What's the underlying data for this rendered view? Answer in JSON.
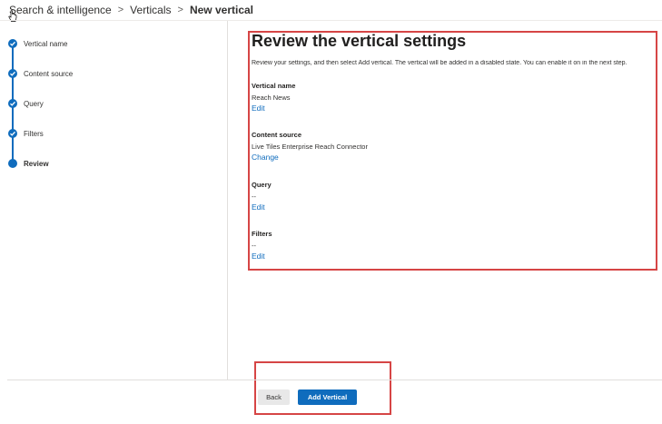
{
  "breadcrumb": {
    "items": [
      "Search & intelligence",
      "Verticals"
    ],
    "current": "New vertical",
    "separator": ">"
  },
  "stepper": {
    "steps": [
      {
        "label": "Vertical name",
        "state": "complete"
      },
      {
        "label": "Content source",
        "state": "complete"
      },
      {
        "label": "Query",
        "state": "complete"
      },
      {
        "label": "Filters",
        "state": "complete"
      },
      {
        "label": "Review",
        "state": "active"
      }
    ],
    "accent": "#0f6cbd"
  },
  "review": {
    "title": "Review the vertical settings",
    "intro": "Review your settings, and then select Add vertical. The vertical will be added in a disabled state. You can enable it on in the next step.",
    "sections": [
      {
        "title": "Vertical name",
        "value": "Reach News",
        "action": "Edit"
      },
      {
        "title": "Content source",
        "value": "Live Tiles Enterprise Reach Connector",
        "action": "Change"
      },
      {
        "title": "Query",
        "value": "--",
        "action": "Edit"
      },
      {
        "title": "Filters",
        "value": "--",
        "action": "Edit"
      }
    ]
  },
  "footer": {
    "back_label": "Back",
    "add_label": "Add Vertical"
  },
  "colors": {
    "link": "#0f6cbd",
    "annotation": "#d64545"
  }
}
